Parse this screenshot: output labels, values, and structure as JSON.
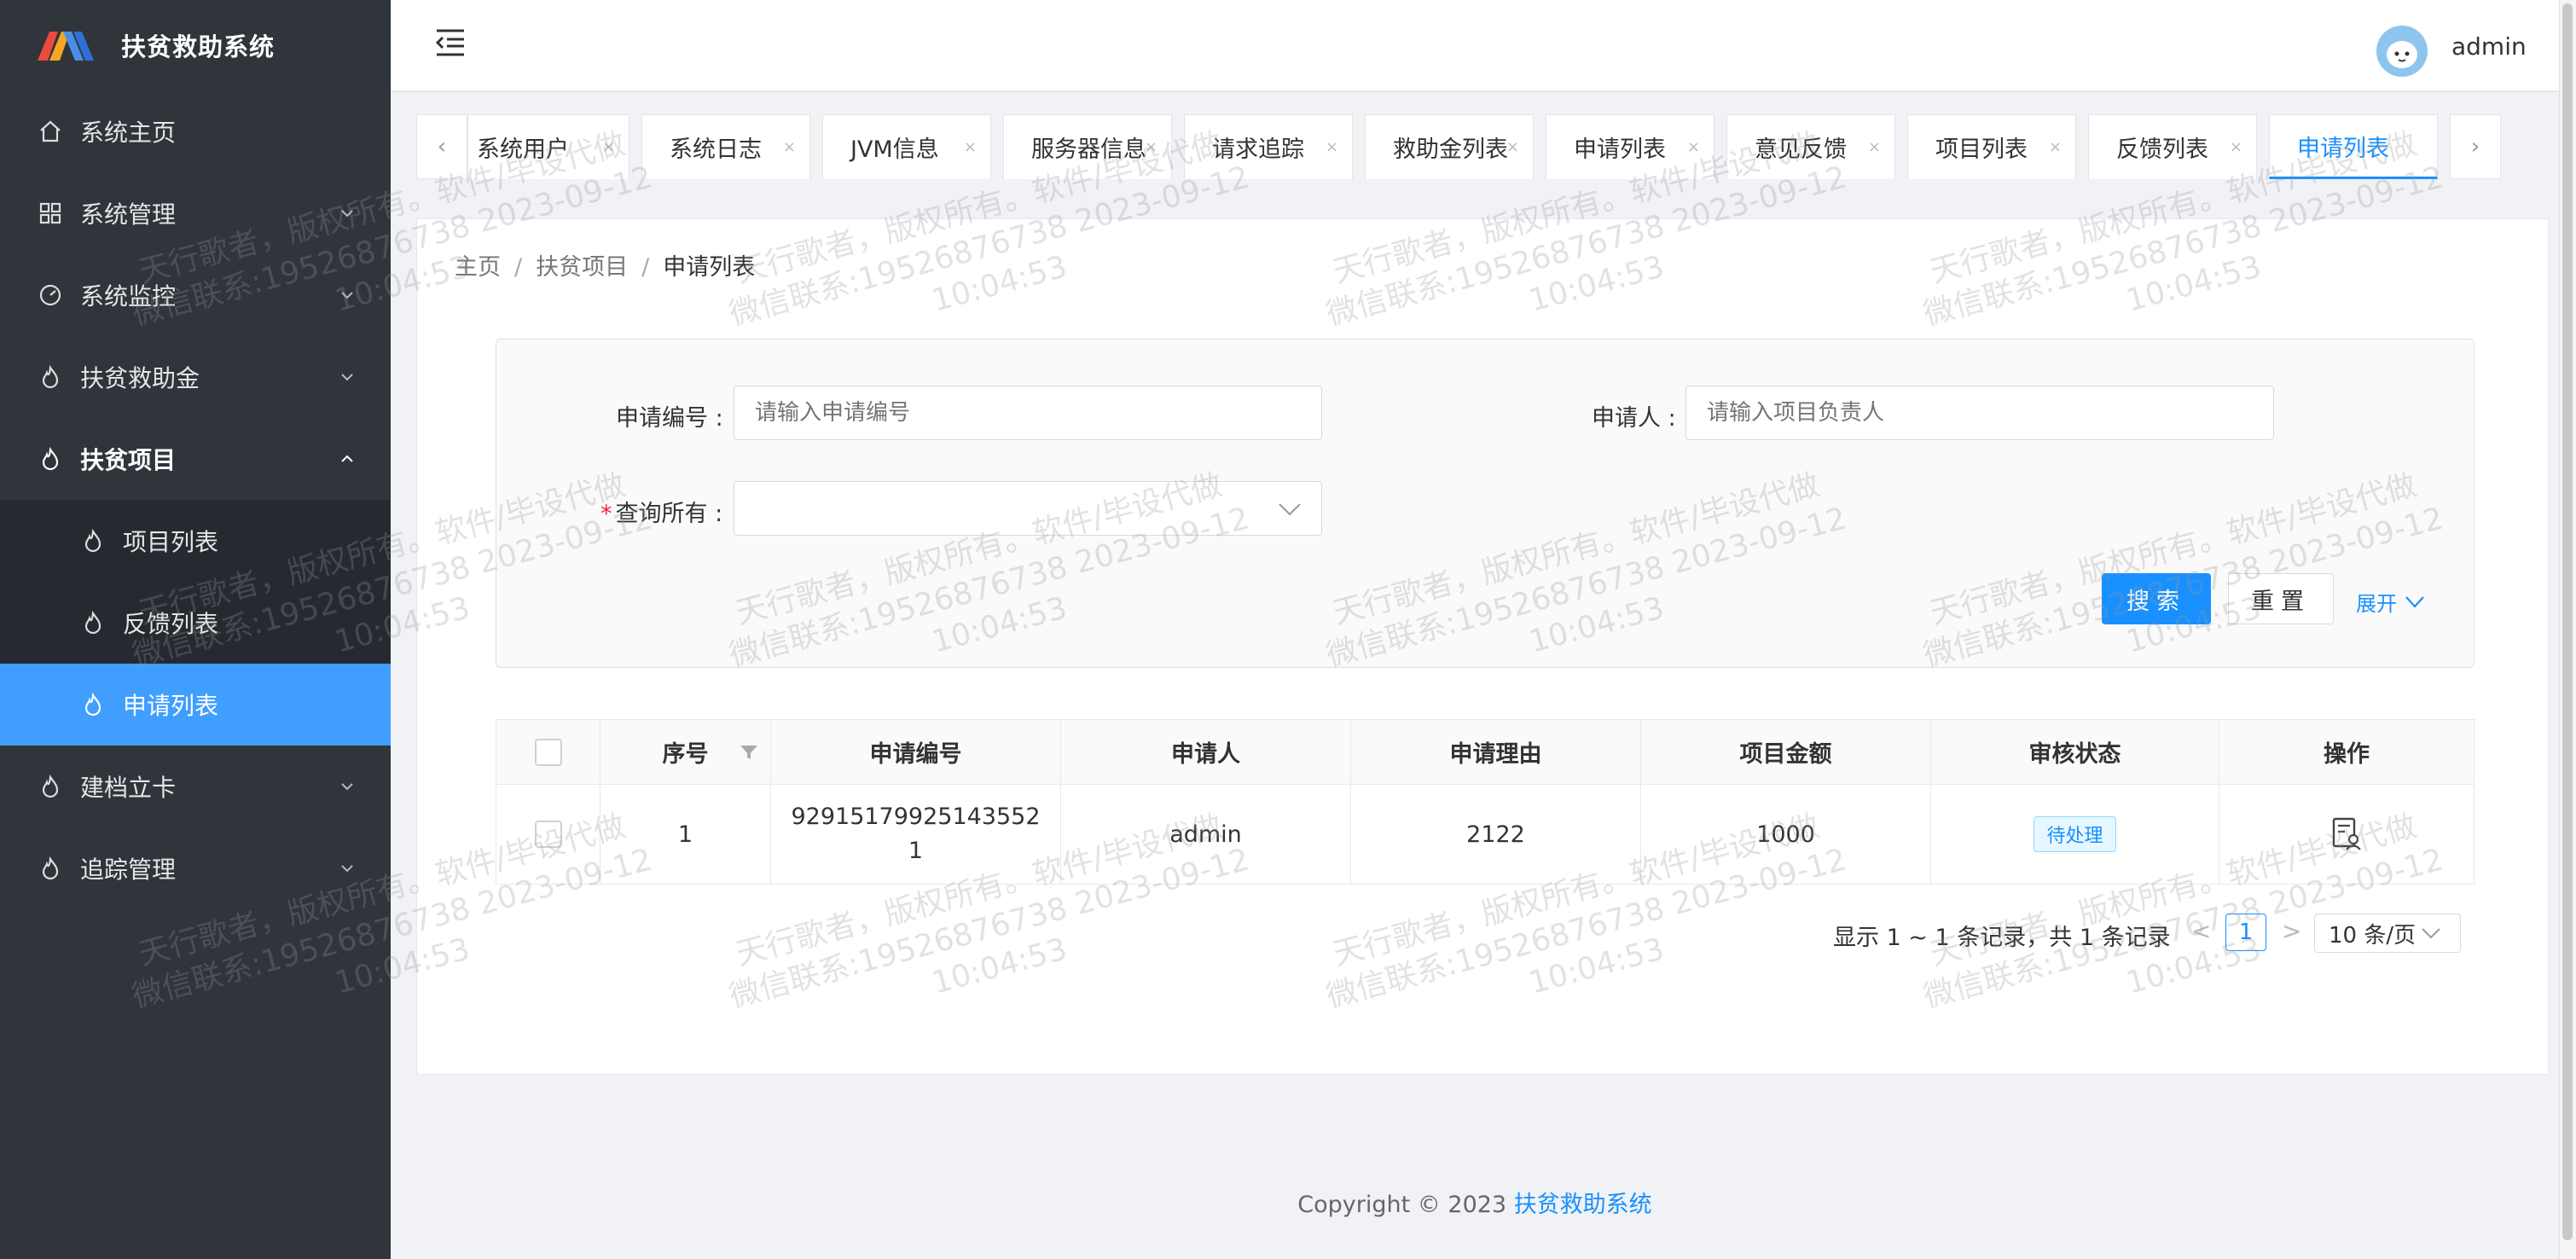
{
  "app": {
    "title": "扶贫救助系统",
    "colors": {
      "accent": "#1890ff",
      "sidebar": "#30343b",
      "active_menu": "#409eff"
    }
  },
  "sidebar": {
    "items": [
      {
        "label": "系统主页",
        "icon": "home-icon"
      },
      {
        "label": "系统管理",
        "icon": "grid-icon"
      },
      {
        "label": "系统监控",
        "icon": "gauge-icon"
      },
      {
        "label": "扶贫救助金",
        "icon": "flame-icon"
      },
      {
        "label": "扶贫项目",
        "icon": "flame-icon",
        "open": true
      },
      {
        "label": "建档立卡",
        "icon": "flame-icon"
      },
      {
        "label": "追踪管理",
        "icon": "flame-icon"
      }
    ],
    "submenu": [
      {
        "label": "项目列表"
      },
      {
        "label": "反馈列表"
      },
      {
        "label": "申请列表",
        "active": true
      }
    ]
  },
  "header": {
    "user": "admin"
  },
  "tabs": [
    {
      "label": "系统用户"
    },
    {
      "label": "系统日志"
    },
    {
      "label": "JVM信息"
    },
    {
      "label": "服务器信息"
    },
    {
      "label": "请求追踪"
    },
    {
      "label": "救助金列表"
    },
    {
      "label": "申请列表"
    },
    {
      "label": "意见反馈"
    },
    {
      "label": "项目列表"
    },
    {
      "label": "反馈列表"
    },
    {
      "label": "申请列表",
      "active": true
    }
  ],
  "tab_arrows": {
    "left": "‹",
    "right": "›"
  },
  "breadcrumb": {
    "items": [
      "主页",
      "扶贫项目",
      "申请列表"
    ],
    "sep": "/"
  },
  "search": {
    "apply_no_label": "申请编号 :",
    "apply_no_placeholder": "请输入申请编号",
    "applicant_label": "申请人 :",
    "applicant_placeholder": "请输入项目负责人",
    "query_all_label": "查询所有 :",
    "query_all_required": "*",
    "search_btn": "搜索",
    "reset_btn": "重置",
    "expand": "展开"
  },
  "table": {
    "headers": [
      "序号",
      "申请编号",
      "申请人",
      "申请理由",
      "项目金额",
      "审核状态",
      "操作"
    ],
    "rows": [
      {
        "index": "1",
        "apply_no_line1": "92915179925143552",
        "apply_no_line2": "1",
        "applicant": "admin",
        "reason": "2122",
        "amount": "1000",
        "status": "待处理"
      }
    ]
  },
  "pagination": {
    "info": "显示 1 ~ 1 条记录，共 1 条记录",
    "prev": "<",
    "current": "1",
    "next": ">",
    "page_size": "10 条/页"
  },
  "footer": {
    "copyright": "Copyright © 2023 ",
    "brand": "扶贫救助系统"
  },
  "watermark": {
    "line1": "天行歌者，版权所有。软件/毕设代做",
    "line2": "微信联系:19526876738 2023-09-12",
    "line3": "10:04:53"
  }
}
